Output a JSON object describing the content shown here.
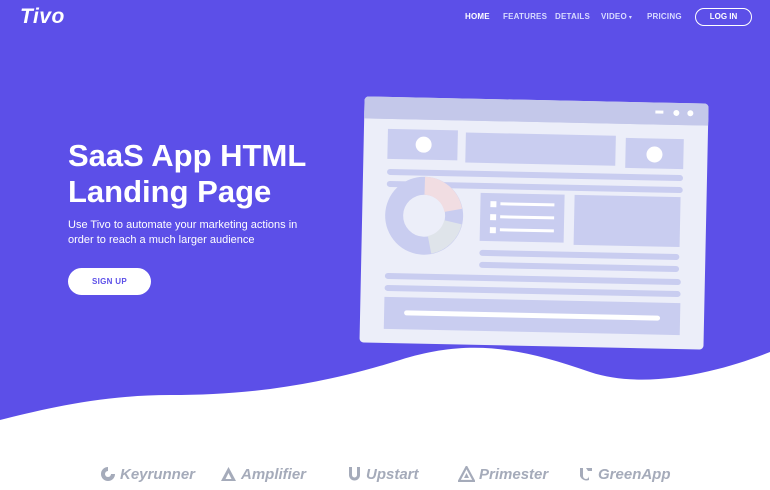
{
  "brand": {
    "logo": "Tivo"
  },
  "nav": {
    "items": [
      {
        "label": "HOME",
        "active": true
      },
      {
        "label": "FEATURES",
        "active": false
      },
      {
        "label": "DETAILS",
        "active": false
      },
      {
        "label": "VIDEO",
        "active": false,
        "dropdown": true
      },
      {
        "label": "PRICING",
        "active": false
      }
    ],
    "login_label": "LOG IN"
  },
  "hero": {
    "title_line1": "SaaS App HTML",
    "title_line2": "Landing Page",
    "subtitle": "Use Tivo to automate your marketing actions in order to reach a much larger audience",
    "signup_label": "SIGN UP"
  },
  "partners": [
    {
      "name": "Keyrunner",
      "icon": "keyrunner-logo"
    },
    {
      "name": "Amplifier",
      "icon": "amplifier-logo"
    },
    {
      "name": "Upstart",
      "icon": "upstart-logo"
    },
    {
      "name": "Primester",
      "icon": "primester-logo"
    },
    {
      "name": "GreenApp",
      "icon": "greenapp-logo"
    }
  ],
  "colors": {
    "hero_bg": "#5c4fe8",
    "mockup_frame": "#e9ebf8",
    "mockup_blocks": "#c9cdf0",
    "partner_text": "#a5abba"
  }
}
